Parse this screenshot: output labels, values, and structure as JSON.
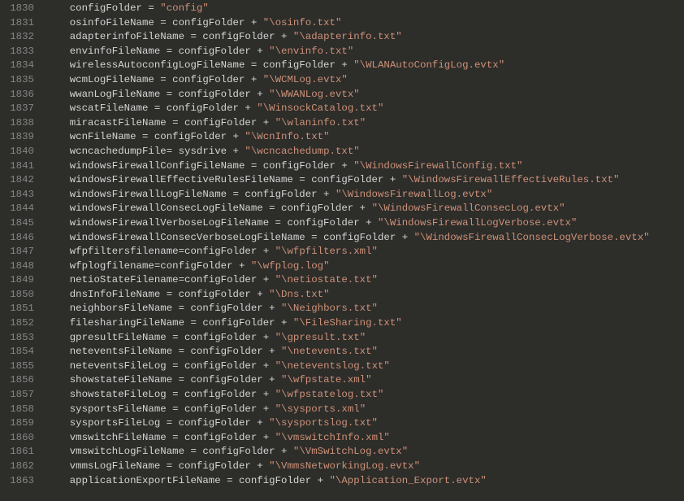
{
  "lines": [
    {
      "num": 1830,
      "var": "configFolder",
      "eq": " = ",
      "parts": [
        "\"config\""
      ]
    },
    {
      "num": 1831,
      "var": "osinfoFileName",
      "eq": " = ",
      "parts": [
        "configFolder",
        " + ",
        "\"\\osinfo.txt\""
      ]
    },
    {
      "num": 1832,
      "var": "adapterinfoFileName",
      "eq": " = ",
      "parts": [
        "configFolder",
        " + ",
        "\"\\adapterinfo.txt\""
      ]
    },
    {
      "num": 1833,
      "var": "envinfoFileName",
      "eq": " = ",
      "parts": [
        "configFolder",
        " + ",
        "\"\\envinfo.txt\""
      ]
    },
    {
      "num": 1834,
      "var": "wirelessAutoconfigLogFileName",
      "eq": " = ",
      "parts": [
        "configFolder",
        " + ",
        "\"\\WLANAutoConfigLog.evtx\""
      ]
    },
    {
      "num": 1835,
      "var": "wcmLogFileName",
      "eq": " = ",
      "parts": [
        "configFolder",
        " + ",
        "\"\\WCMLog.evtx\""
      ]
    },
    {
      "num": 1836,
      "var": "wwanLogFileName",
      "eq": " = ",
      "parts": [
        "configFolder",
        " + ",
        "\"\\WWANLog.evtx\""
      ]
    },
    {
      "num": 1837,
      "var": "wscatFileName",
      "eq": " = ",
      "parts": [
        "configFolder",
        " + ",
        "\"\\WinsockCatalog.txt\""
      ]
    },
    {
      "num": 1838,
      "var": "miracastFileName",
      "eq": " = ",
      "parts": [
        "configFolder",
        " + ",
        "\"\\wlaninfo.txt\""
      ]
    },
    {
      "num": 1839,
      "var": "wcnFileName",
      "eq": " = ",
      "parts": [
        "configFolder",
        " + ",
        "\"\\WcnInfo.txt\""
      ]
    },
    {
      "num": 1840,
      "var": "wcncachedumpFile",
      "eq": "= ",
      "parts": [
        "sysdrive",
        " + ",
        "\"\\wcncachedump.txt\""
      ]
    },
    {
      "num": 1841,
      "var": "windowsFirewallConfigFileName",
      "eq": " = ",
      "parts": [
        "configFolder",
        " + ",
        "\"\\WindowsFirewallConfig.txt\""
      ]
    },
    {
      "num": 1842,
      "var": "windowsFirewallEffectiveRulesFileName",
      "eq": " = ",
      "parts": [
        "configFolder",
        " + ",
        "\"\\WindowsFirewallEffectiveRules.txt\""
      ]
    },
    {
      "num": 1843,
      "var": "windowsFirewallLogFileName",
      "eq": " = ",
      "parts": [
        "configFolder",
        " + ",
        "\"\\WindowsFirewallLog.evtx\""
      ]
    },
    {
      "num": 1844,
      "var": "windowsFirewallConsecLogFileName",
      "eq": " = ",
      "parts": [
        "configFolder",
        " + ",
        "\"\\WindowsFirewallConsecLog.evtx\""
      ]
    },
    {
      "num": 1845,
      "var": "windowsFirewallVerboseLogFileName",
      "eq": " = ",
      "parts": [
        "configFolder",
        " + ",
        "\"\\WindowsFirewallLogVerbose.evtx\""
      ]
    },
    {
      "num": 1846,
      "var": "windowsFirewallConsecVerboseLogFileName",
      "eq": " = ",
      "parts": [
        "configFolder",
        " + ",
        "\"\\WindowsFirewallConsecLogVerbose.evtx\""
      ]
    },
    {
      "num": 1847,
      "var": "wfpfiltersfilename",
      "eq": "=",
      "parts": [
        "configFolder",
        " + ",
        "\"\\wfpfilters.xml\""
      ]
    },
    {
      "num": 1848,
      "var": "wfplogfilename",
      "eq": "=",
      "parts": [
        "configFolder",
        " + ",
        "\"\\wfplog.log\""
      ]
    },
    {
      "num": 1849,
      "var": "netioStateFilename",
      "eq": "=",
      "parts": [
        "configFolder",
        " + ",
        "\"\\netiostate.txt\""
      ]
    },
    {
      "num": 1850,
      "var": "dnsInfoFileName",
      "eq": " = ",
      "parts": [
        "configFolder",
        " + ",
        "\"\\Dns.txt\""
      ]
    },
    {
      "num": 1851,
      "var": "neighborsFileName",
      "eq": " = ",
      "parts": [
        "configFolder",
        " + ",
        "\"\\Neighbors.txt\""
      ]
    },
    {
      "num": 1852,
      "var": "filesharingFileName",
      "eq": " = ",
      "parts": [
        "configFolder",
        " + ",
        "\"\\FileSharing.txt\""
      ]
    },
    {
      "num": 1853,
      "var": "gpresultFileName",
      "eq": " = ",
      "parts": [
        "configFolder",
        " + ",
        "\"\\gpresult.txt\""
      ]
    },
    {
      "num": 1854,
      "var": "neteventsFileName",
      "eq": " = ",
      "parts": [
        "configFolder",
        " + ",
        "\"\\netevents.txt\""
      ]
    },
    {
      "num": 1855,
      "var": "neteventsFileLog",
      "eq": " = ",
      "parts": [
        "configFolder",
        " + ",
        "\"\\neteventslog.txt\""
      ]
    },
    {
      "num": 1856,
      "var": "showstateFileName",
      "eq": " = ",
      "parts": [
        "configFolder",
        " + ",
        "\"\\wfpstate.xml\""
      ]
    },
    {
      "num": 1857,
      "var": "showstateFileLog",
      "eq": " = ",
      "parts": [
        "configFolder",
        " + ",
        "\"\\wfpstatelog.txt\""
      ]
    },
    {
      "num": 1858,
      "var": "sysportsFileName",
      "eq": " = ",
      "parts": [
        "configFolder",
        " + ",
        "\"\\sysports.xml\""
      ]
    },
    {
      "num": 1859,
      "var": "sysportsFileLog",
      "eq": " = ",
      "parts": [
        "configFolder",
        " + ",
        "\"\\sysportslog.txt\""
      ]
    },
    {
      "num": 1860,
      "var": "vmswitchFileName",
      "eq": " = ",
      "parts": [
        "configFolder",
        " + ",
        "\"\\vmswitchInfo.xml\""
      ]
    },
    {
      "num": 1861,
      "var": "vmswitchLogFileName",
      "eq": " = ",
      "parts": [
        "configFolder",
        " + ",
        "\"\\VmSwitchLog.evtx\""
      ]
    },
    {
      "num": 1862,
      "var": "vmmsLogFileName",
      "eq": " = ",
      "parts": [
        "configFolder",
        " + ",
        "\"\\VmmsNetworkingLog.evtx\""
      ]
    },
    {
      "num": 1863,
      "var": "applicationExportFileName",
      "eq": " = ",
      "parts": [
        "configFolder",
        " + ",
        "\"\\Application_Export.evtx\""
      ]
    }
  ],
  "indent": "    "
}
